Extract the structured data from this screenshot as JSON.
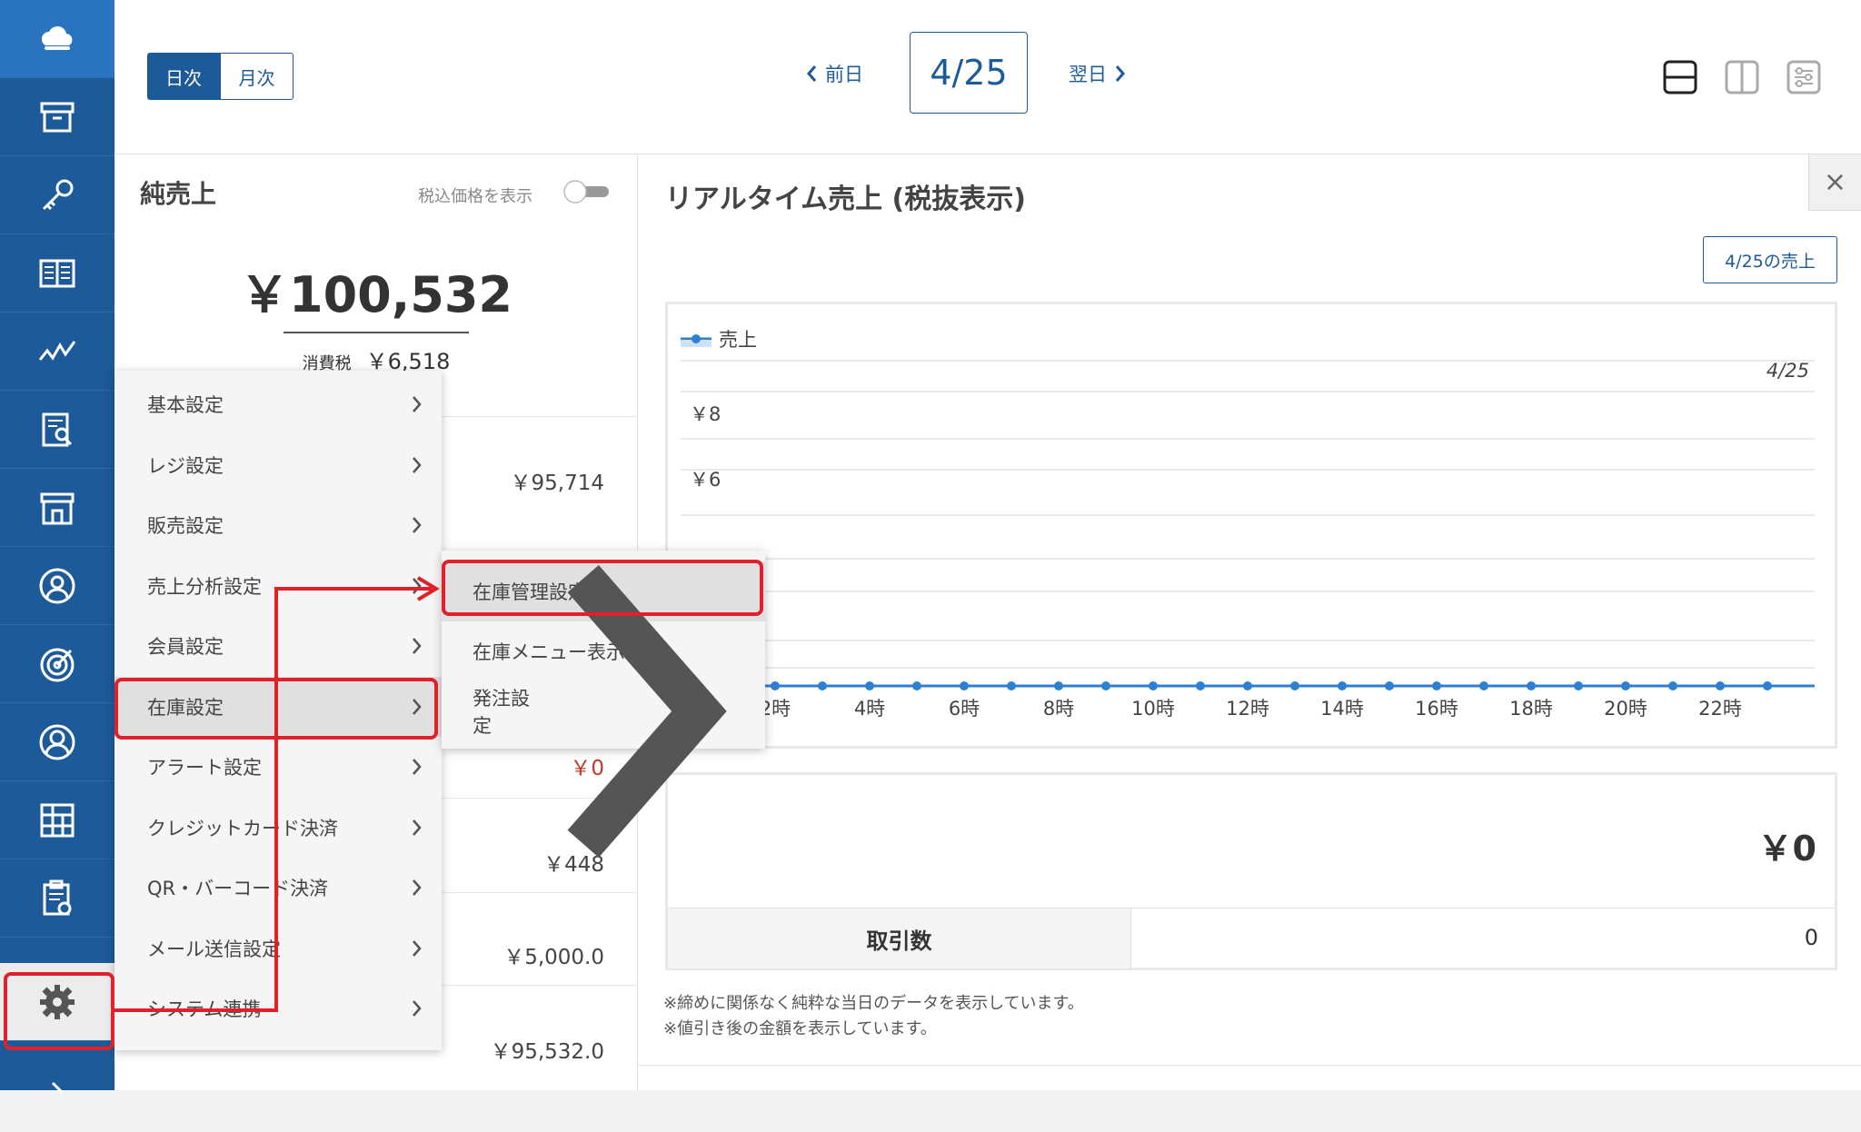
{
  "topbar": {
    "view_daily": "日次",
    "view_monthly": "月次",
    "prev_label": "前日",
    "date": "4/25",
    "next_label": "翌日"
  },
  "left_panel": {
    "title": "純売上",
    "tax_toggle_label": "税込価格を表示",
    "tax_toggle_on": false,
    "net_sales": "￥100,532",
    "tax_label": "消費税",
    "tax_value": "￥6,518",
    "rows": [
      "￥95,714",
      "￥0",
      "￥448",
      "￥5,000.0",
      "￥95,532.0"
    ]
  },
  "right_panel": {
    "title": "リアルタイム売上 (税抜表示)",
    "sales_button": "4/25の売上",
    "summary_amount": "￥0",
    "transactions_label": "取引数",
    "transactions_value": "0",
    "notes": [
      "※締めに関係なく純粋な当日のデータを表示しています。",
      "※値引き後の金額を表示しています。"
    ]
  },
  "chart_data": {
    "type": "line",
    "legend": "売上",
    "legend_position": "top-left",
    "date_label": "4/25",
    "y_tick_labels": [
      "￥8",
      "￥6"
    ],
    "x_tick_labels": [
      "2時",
      "4時",
      "6時",
      "8時",
      "10時",
      "12時",
      "14時",
      "16時",
      "18時",
      "20時",
      "22時"
    ],
    "series": [
      {
        "name": "売上",
        "x": [
          1,
          2,
          3,
          4,
          5,
          6,
          7,
          8,
          9,
          10,
          11,
          12,
          13,
          14,
          15,
          16,
          17,
          18,
          19,
          20,
          21,
          22,
          23
        ],
        "values": [
          0,
          0,
          0,
          0,
          0,
          0,
          0,
          0,
          0,
          0,
          0,
          0,
          0,
          0,
          0,
          0,
          0,
          0,
          0,
          0,
          0,
          0,
          0
        ]
      }
    ],
    "color": "#2f7fd0"
  },
  "menu": {
    "items": [
      {
        "label": "基本設定",
        "has_submenu": true
      },
      {
        "label": "レジ設定",
        "has_submenu": true
      },
      {
        "label": "販売設定",
        "has_submenu": true
      },
      {
        "label": "売上分析設定",
        "has_submenu": true
      },
      {
        "label": "会員設定",
        "has_submenu": true
      },
      {
        "label": "在庫設定",
        "has_submenu": true
      },
      {
        "label": "アラート設定",
        "has_submenu": true
      },
      {
        "label": "クレジットカード決済",
        "has_submenu": true
      },
      {
        "label": "QR・バーコード決済",
        "has_submenu": true
      },
      {
        "label": "メール送信設定",
        "has_submenu": true
      },
      {
        "label": "システム連携",
        "has_submenu": true
      }
    ],
    "submenu": [
      {
        "label": "在庫管理設定",
        "has_submenu": false
      },
      {
        "label": "在庫メニュー表示設定",
        "has_submenu": false
      },
      {
        "label": "発注設定",
        "has_submenu": true
      }
    ]
  },
  "colors": {
    "brand": "#1d5a99",
    "highlight": "#e0202a",
    "negative": "#c0392b"
  }
}
